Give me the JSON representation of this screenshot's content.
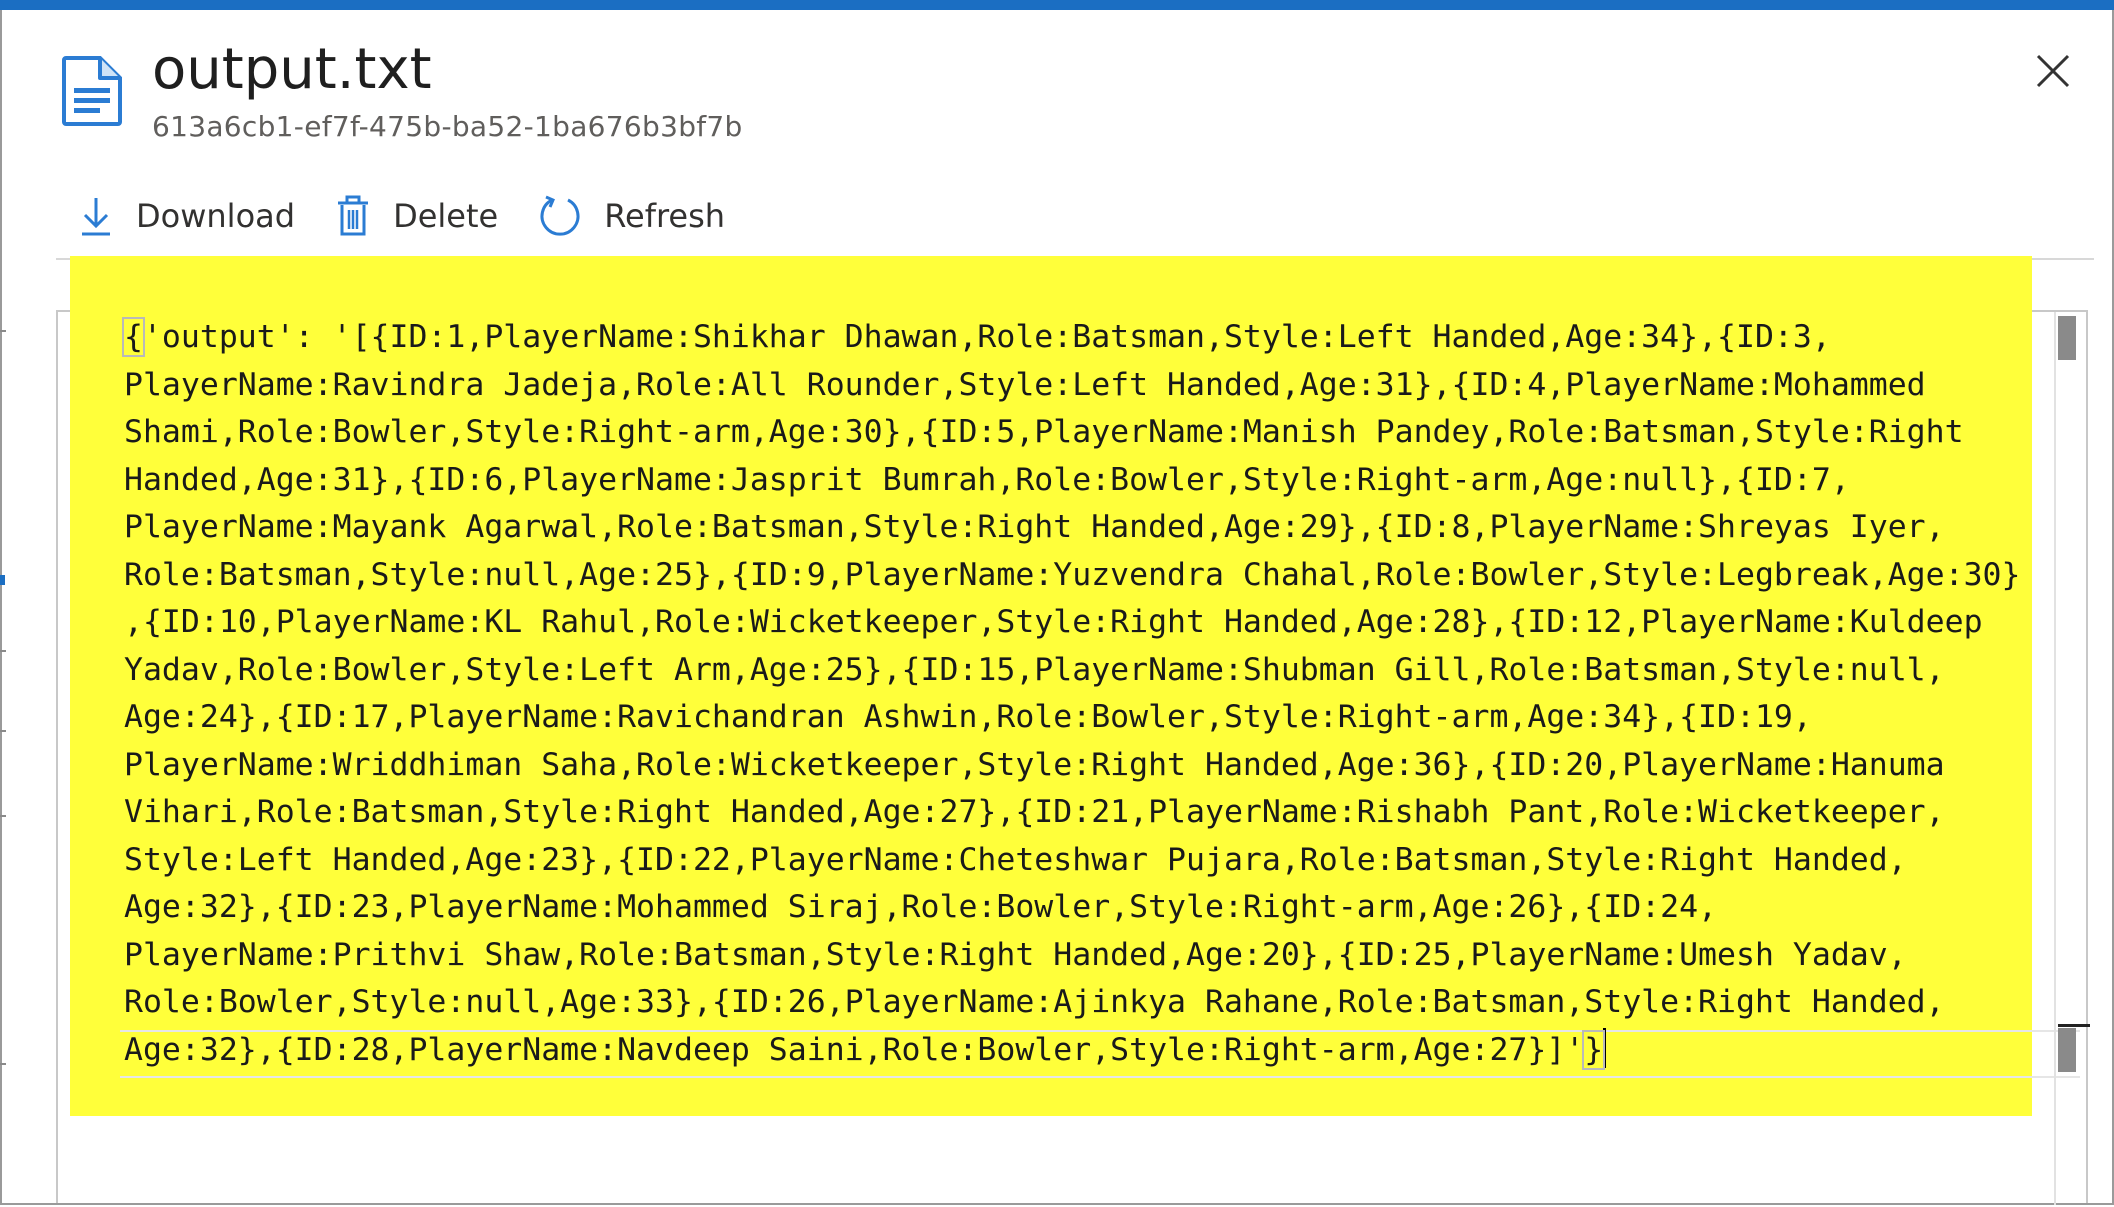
{
  "colors": {
    "accent": "#1b6ec2",
    "highlight": "#ffff3a",
    "title_text": "#1f1f1f",
    "subtitle_text": "#605e5c",
    "toolbar_icon": "#2b7cd3"
  },
  "header": {
    "file_icon": "document-icon",
    "title": "output.txt",
    "subtitle": "613a6cb1-ef7f-475b-ba52-1ba676b3bf7b",
    "close_icon": "close-icon"
  },
  "toolbar": {
    "download": {
      "label": "Download",
      "icon": "download-icon"
    },
    "delete": {
      "label": "Delete",
      "icon": "trash-icon"
    },
    "refresh": {
      "label": "Refresh",
      "icon": "refresh-icon"
    }
  },
  "editor": {
    "lines": [
      "{'output': '[{ID:1,PlayerName:Shikhar Dhawan,Role:Batsman,Style:Left Handed,Age:34},{ID:3,",
      "PlayerName:Ravindra Jadeja,Role:All Rounder,Style:Left Handed,Age:31},{ID:4,PlayerName:Mohammed",
      "Shami,Role:Bowler,Style:Right-arm,Age:30},{ID:5,PlayerName:Manish Pandey,Role:Batsman,Style:Right",
      "Handed,Age:31},{ID:6,PlayerName:Jasprit Bumrah,Role:Bowler,Style:Right-arm,Age:null},{ID:7,",
      "PlayerName:Mayank Agarwal,Role:Batsman,Style:Right Handed,Age:29},{ID:8,PlayerName:Shreyas Iyer,",
      "Role:Batsman,Style:null,Age:25},{ID:9,PlayerName:Yuzvendra Chahal,Role:Bowler,Style:Legbreak,Age:30}",
      ",{ID:10,PlayerName:KL Rahul,Role:Wicketkeeper,Style:Right Handed,Age:28},{ID:12,PlayerName:Kuldeep",
      "Yadav,Role:Bowler,Style:Left Arm,Age:25},{ID:15,PlayerName:Shubman Gill,Role:Batsman,Style:null,",
      "Age:24},{ID:17,PlayerName:Ravichandran Ashwin,Role:Bowler,Style:Right-arm,Age:34},{ID:19,",
      "PlayerName:Wriddhiman Saha,Role:Wicketkeeper,Style:Right Handed,Age:36},{ID:20,PlayerName:Hanuma",
      "Vihari,Role:Batsman,Style:Right Handed,Age:27},{ID:21,PlayerName:Rishabh Pant,Role:Wicketkeeper,",
      "Style:Left Handed,Age:23},{ID:22,PlayerName:Cheteshwar Pujara,Role:Batsman,Style:Right Handed,",
      "Age:32},{ID:23,PlayerName:Mohammed Siraj,Role:Bowler,Style:Right-arm,Age:26},{ID:24,",
      "PlayerName:Prithvi Shaw,Role:Batsman,Style:Right Handed,Age:20},{ID:25,PlayerName:Umesh Yadav,",
      "Role:Bowler,Style:null,Age:33},{ID:26,PlayerName:Ajinkya Rahane,Role:Batsman,Style:Right Handed,",
      "Age:32},{ID:28,PlayerName:Navdeep Saini,Role:Bowler,Style:Right-arm,Age:27}]'}"
    ]
  }
}
